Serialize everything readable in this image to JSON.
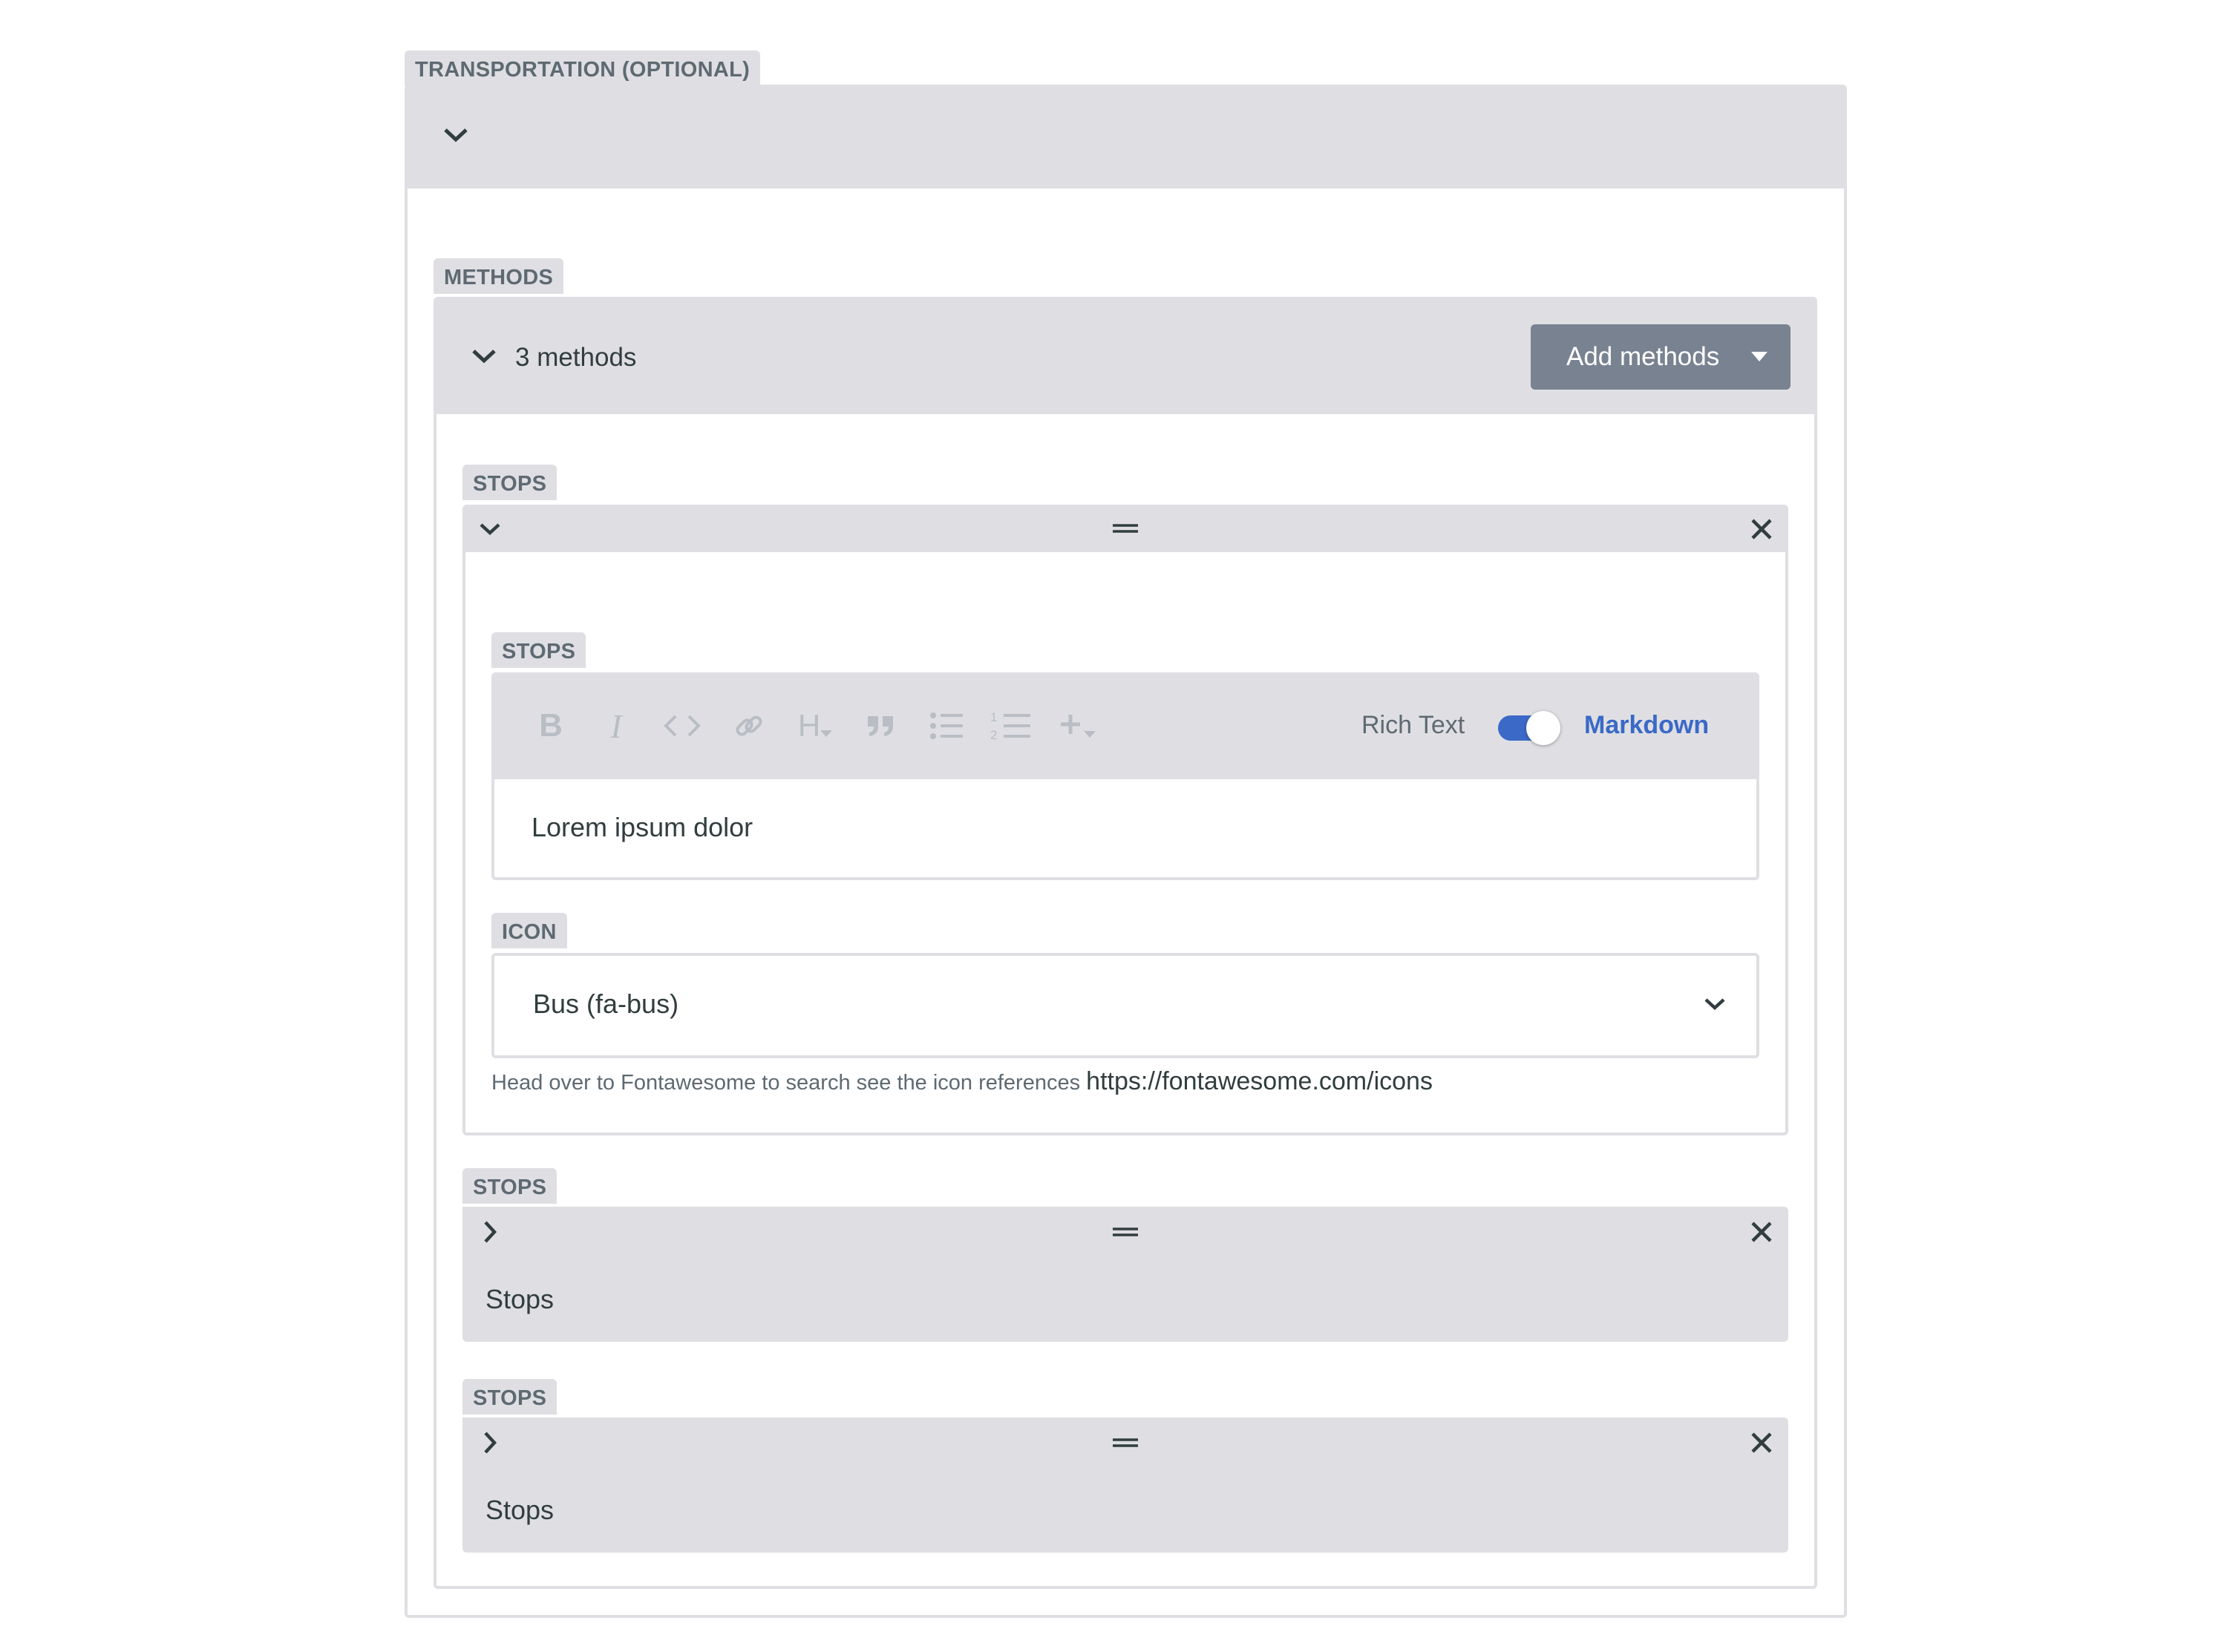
{
  "transportation": {
    "label": "TRANSPORTATION (OPTIONAL)",
    "methods": {
      "label": "METHODS",
      "count_text": "3 methods",
      "add_button_label": "Add methods",
      "items": [
        {
          "label": "STOPS",
          "expanded": true,
          "stops_field": {
            "label": "STOPS",
            "toolbar": {
              "buttons": [
                "bold-icon",
                "italic-icon",
                "code-icon",
                "link-icon",
                "heading-icon",
                "quote-icon",
                "bulleted-list-icon",
                "numbered-list-icon",
                "add-component-icon"
              ],
              "rich_text_label": "Rich Text",
              "markdown_label": "Markdown",
              "markdown_enabled": true
            },
            "value": "Lorem ipsum dolor"
          },
          "icon_field": {
            "label": "ICON",
            "selected": "Bus (fa-bus)",
            "hint": "Head over to Fontawesome to search see the icon references",
            "hint_link": "https://fontawesome.com/icons"
          }
        },
        {
          "label": "STOPS",
          "expanded": false,
          "summary": "Stops"
        },
        {
          "label": "STOPS",
          "expanded": false,
          "summary": "Stops"
        }
      ]
    }
  },
  "colors": {
    "panel_bg": "#dfdfe3",
    "label_text": "#5e6a72",
    "button_bg": "#798291",
    "toggle_accent": "#3a69c7",
    "markdown_text": "#3a69c7"
  }
}
